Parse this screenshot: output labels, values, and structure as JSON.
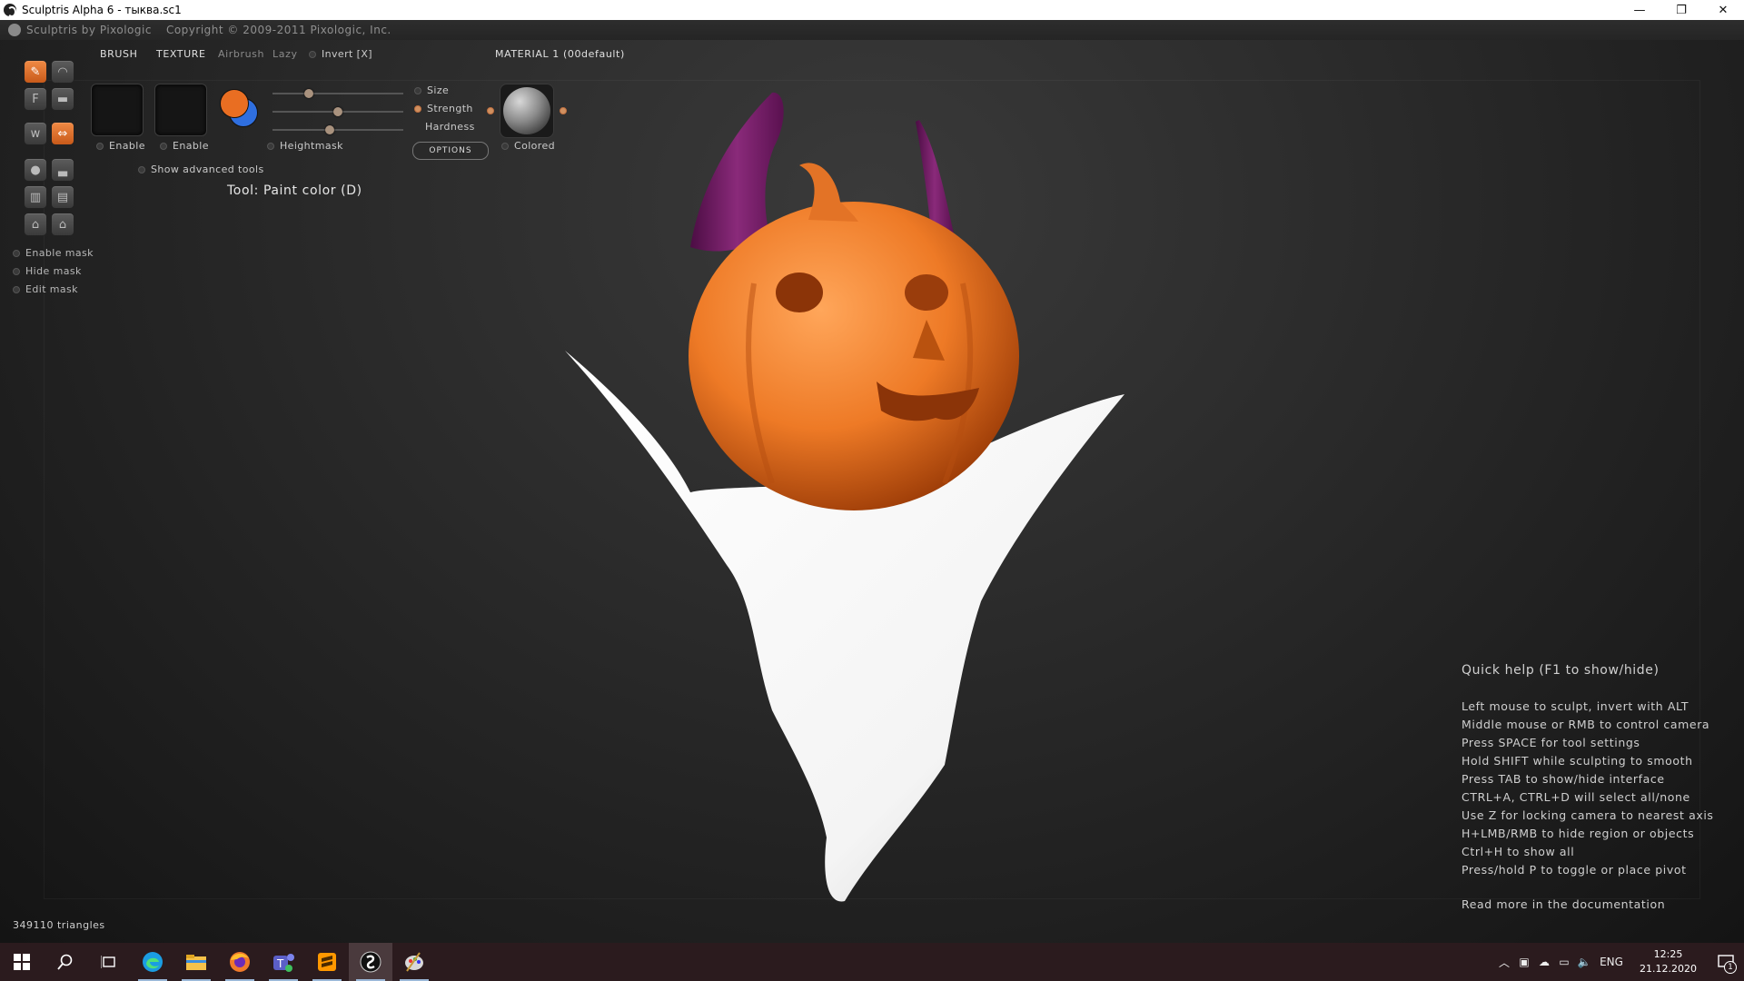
{
  "window": {
    "title": "Sculptris Alpha 6 - тыква.sc1",
    "minimize": "—",
    "maximize": "❐",
    "close": "✕"
  },
  "header": {
    "app_name": "Sculptris by Pixologic",
    "copyright": "Copyright © 2009-2011 Pixologic, Inc."
  },
  "panel": {
    "brush_label": "BRUSH",
    "texture_label": "TEXTURE",
    "airbrush_label": "Airbrush",
    "lazy_label": "Lazy",
    "invert_label": "Invert [X]",
    "brush_enable": "Enable",
    "texture_enable": "Enable",
    "heightmask": "Heightmask",
    "show_advanced": "Show advanced tools",
    "size_label": "Size",
    "strength_label": "Strength",
    "hardness_label": "Hardness",
    "options_label": "OPTIONS",
    "material_label": "MATERIAL 1 (00default)",
    "colored_label": "Colored",
    "primary_color": "#e96e22",
    "secondary_color": "#2f6fe0",
    "size_value": 0.28,
    "strength_value": 0.5,
    "hardness_value": 0.44
  },
  "tools": {
    "mask_enable": "Enable mask",
    "mask_hide": "Hide mask",
    "mask_edit": "Edit mask"
  },
  "status": {
    "tool": "Tool: Paint color (D)",
    "triangles": "349110 triangles"
  },
  "quick_help": {
    "title": "Quick help (F1 to show/hide)",
    "lines": [
      "Left mouse to sculpt, invert with ALT",
      "Middle mouse or RMB to control camera",
      "Press SPACE for tool settings",
      "Hold SHIFT while sculpting to smooth",
      "Press TAB to show/hide interface",
      "CTRL+A, CTRL+D will select all/none",
      "Use Z for locking camera to nearest axis",
      "H+LMB/RMB to hide region or objects",
      "Ctrl+H to show all",
      "Press/hold P to toggle or place pivot"
    ],
    "more": "Read more in the documentation"
  },
  "taskbar": {
    "lang": "ENG",
    "time": "12:25",
    "date": "21.12.2020",
    "notifications": "1"
  },
  "colors": {
    "pumpkin": "#ea7a26",
    "horns": "#7a1c6a",
    "ghost": "#ffffff",
    "accent": "#e9742b"
  }
}
